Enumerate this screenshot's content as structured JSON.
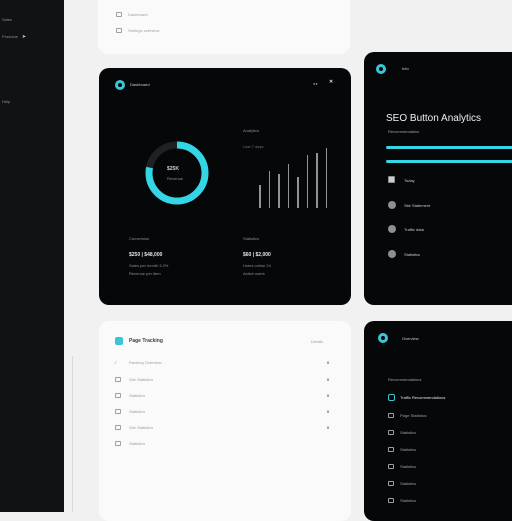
{
  "sidebar": {
    "items": [
      {
        "label": "Sales"
      },
      {
        "label": "Products"
      },
      {
        "label": "Help"
      }
    ]
  },
  "top_card": {
    "items": [
      {
        "label": "Dashboard"
      },
      {
        "label": "Settings overview"
      }
    ]
  },
  "sales_card": {
    "title": "Dashboard",
    "donut_value": "$25K",
    "donut_sub": "Revenue",
    "donut_progress": 0.78,
    "bars_title": "Analytics",
    "bars_sub": "Last 7 days",
    "bars": [
      0.38,
      0.62,
      0.57,
      0.74,
      0.52,
      0.88,
      0.92,
      1.0
    ],
    "stat1_label": "Conversion",
    "stat1_value": "$250 | $48,000",
    "stat1_sub": "Sales per month 3.2%",
    "stat1_sub2": "Revenue per item",
    "stat2_label": "Statistics",
    "stat2_value": "$60 | $2,000",
    "stat2_sub": "Users online 24",
    "stat2_sub2": "Active users"
  },
  "seo_card": {
    "header": "Info",
    "title": "SEO Button Analytics",
    "subtitle": "Recommendation",
    "items": [
      {
        "label": "Today",
        "icon": "calendar-icon"
      },
      {
        "label": "Site Statement",
        "icon": "globe-icon"
      },
      {
        "label": "Traffic data",
        "icon": "target-icon"
      },
      {
        "label": "Statistics",
        "icon": "settings-icon"
      }
    ]
  },
  "tracking_card": {
    "title": "Page Tracking",
    "action": "Details",
    "rows": [
      {
        "label": "Ranking Overview",
        "value": "0",
        "icon": "chart-icon"
      },
      {
        "label": "Site Statistics",
        "value": "0",
        "icon": "doc-icon"
      },
      {
        "label": "Statistics",
        "value": "0",
        "icon": "doc-icon"
      },
      {
        "label": "Statistics",
        "value": "0",
        "icon": "doc-icon"
      },
      {
        "label": "Site Statistics",
        "value": "0",
        "icon": "doc-icon"
      },
      {
        "label": "Statistics",
        "value": "",
        "icon": "doc-icon"
      }
    ]
  },
  "bottom_right_card": {
    "header": "Overview",
    "subheader": "Recommendations",
    "highlight": "Traffic Recommendations",
    "rows": [
      {
        "label": "Page Statistics"
      },
      {
        "label": "Statistics"
      },
      {
        "label": "Statistics"
      },
      {
        "label": "Statistics"
      },
      {
        "label": "Statistics"
      },
      {
        "label": "Statistics"
      }
    ]
  },
  "colors": {
    "accent": "#39c7d8",
    "dark_card": "#060708",
    "light_card": "#fafafa",
    "sidebar": "#101214"
  }
}
